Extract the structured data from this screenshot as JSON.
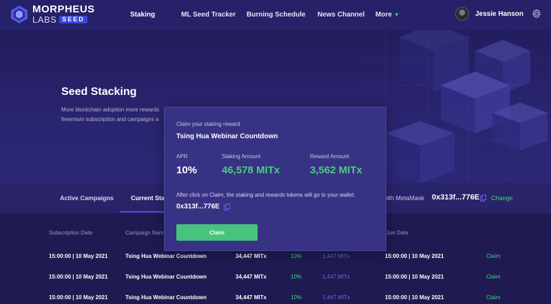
{
  "header": {
    "logo_top": "MORPHEUS",
    "logo_labs": "LABS",
    "logo_seed": "SEED",
    "nav": [
      {
        "label": "Staking",
        "active": true
      },
      {
        "label": "ML Seed Tracker"
      },
      {
        "label": "Burning Schedule"
      },
      {
        "label": "News Channel"
      },
      {
        "label": "More",
        "icon": "caret-down-icon"
      }
    ],
    "user_name": "Jessie Hanson",
    "settings_icon": "gear-icon"
  },
  "hero": {
    "title": "Seed Stacking",
    "description_line1": "More blockchain adoption more rewards",
    "description_line2": "freemium subscription and campaigns a"
  },
  "tabs": {
    "items": [
      "Active Campaigns",
      "Current Stak"
    ],
    "metamask_label": "with MetaMask",
    "wallet": "0x313f...776E",
    "change_label": "Change"
  },
  "table": {
    "headers": [
      "Subscription Date",
      "Campaign Nam",
      "Due Date"
    ],
    "rows": [
      {
        "date": "15:00:00 | 10 May 2021",
        "campaign": "Tsing Hua Webinar Countdown",
        "amount": "34,447 MITx",
        "apr": "10%",
        "reward": "1,447 MITx",
        "due": "15:00:00 | 10 May 2021",
        "action": "Claim"
      },
      {
        "date": "15:00:00 | 10 May 2021",
        "campaign": "Tsing Hua Webinar Countdown",
        "amount": "34,447 MITx",
        "apr": "10%",
        "reward": "1,447 MITx",
        "due": "15:00:00 | 10 May 2021",
        "action": "Claim"
      },
      {
        "date": "15:00:00 | 10 May 2021",
        "campaign": "Tsing Hua Webinar Countdown",
        "amount": "34,447 MITx",
        "apr": "10%",
        "reward": "1,447 MITx",
        "due": "15:00:00 | 10 May 2021",
        "action": "Claim"
      }
    ]
  },
  "modal": {
    "subtitle": "Claim your staking reward",
    "title": "Tsing Hua Webinar Countdown",
    "apr_label": "APR",
    "apr_value": "10%",
    "staking_label": "Staking Amount",
    "staking_value": "46,578 MITx",
    "reward_label": "Reward Amount",
    "reward_value": "3,562 MITx",
    "note": "After click on Claim, the staking and rewards tokens will go to your wallet:",
    "wallet": "0x313f...776E",
    "button_label": "Claim"
  },
  "colors": {
    "accent_green": "#45d17e",
    "accent_blue": "#4a55e0",
    "background": "#1e1a4f"
  }
}
